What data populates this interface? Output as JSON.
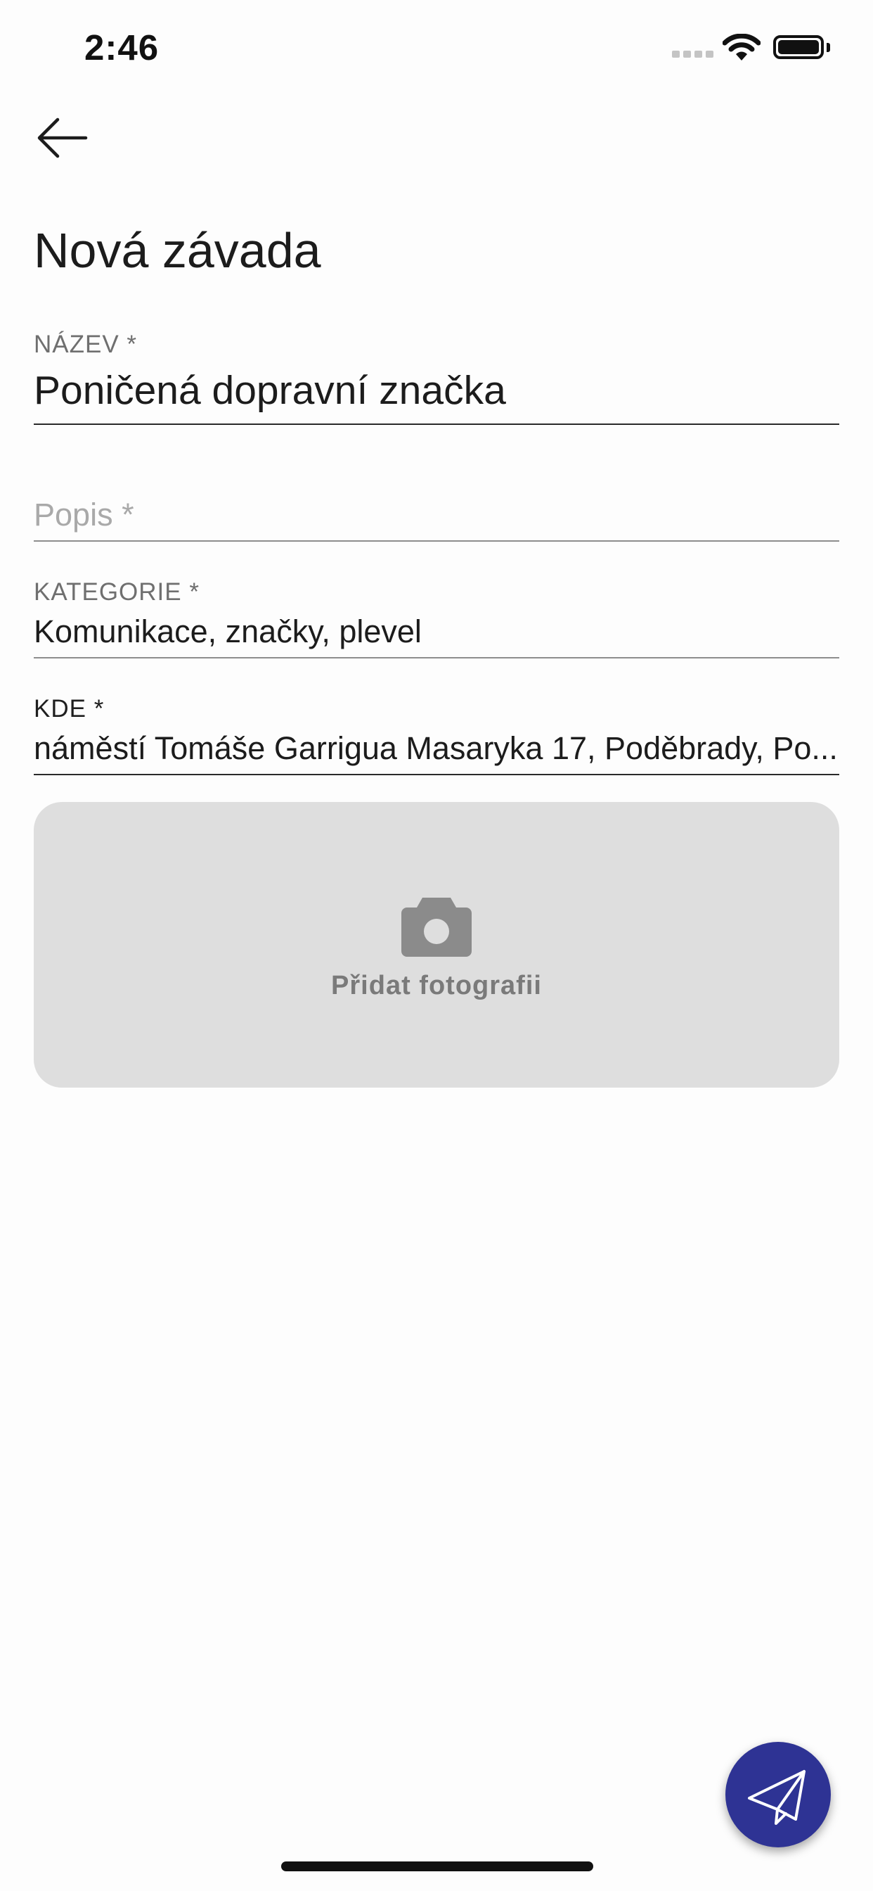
{
  "status_bar": {
    "time": "2:46",
    "icons": [
      "signal-dots-icon",
      "wifi-icon",
      "battery-icon"
    ]
  },
  "header": {
    "back_icon": "arrow-left-icon",
    "title": "Nová závada"
  },
  "form": {
    "name": {
      "label": "NÁZEV *",
      "value": "Poničená dopravní značka"
    },
    "description": {
      "placeholder": "Popis *",
      "value": ""
    },
    "category": {
      "label": "KATEGORIE *",
      "value": "Komunikace, značky, plevel"
    },
    "location": {
      "label": "KDE *",
      "value": "náměstí Tomáše Garrigua Masaryka 17, Poděbrady, Po..."
    }
  },
  "photo": {
    "icon": "camera-icon",
    "label": "Přidat fotografii"
  },
  "fab": {
    "icon": "paper-plane-icon"
  },
  "colors": {
    "accent": "#2e3394",
    "photo_background": "#dedede",
    "label_gray": "#6f6f6f"
  }
}
